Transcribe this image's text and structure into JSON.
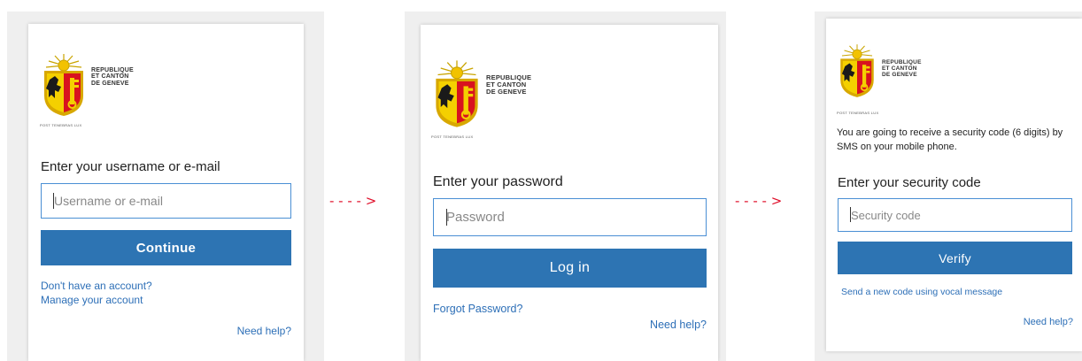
{
  "colors": {
    "accent_blue": "#2d74b3",
    "link_blue": "#2d6fb7",
    "arrow_red": "#e0102b",
    "input_border": "#4a8fd4"
  },
  "logo": {
    "line1": "REPUBLIQUE",
    "line2": "ET CANTON",
    "line3": "DE GENEVE",
    "motto": "POST TENEBRAS LUX"
  },
  "steps": [
    {
      "heading": "Enter your username or e-mail",
      "input_placeholder": "Username or e-mail",
      "button_label": "Continue",
      "link_no_account": "Don't have an account?",
      "link_manage_account": "Manage your account",
      "help_label": "Need help?"
    },
    {
      "heading": "Enter your password",
      "input_placeholder": "Password",
      "button_label": "Log in",
      "link_forgot_password": "Forgot Password?",
      "help_label": "Need help?"
    },
    {
      "description": "You are going to receive a security code (6 digits) by SMS on your mobile phone.",
      "heading": "Enter your security code",
      "input_placeholder": "Security code",
      "button_label": "Verify",
      "link_vocal": "Send a new code using vocal message",
      "help_label": "Need help?"
    }
  ],
  "arrows": [
    "- - - - >",
    "- - - - >"
  ]
}
